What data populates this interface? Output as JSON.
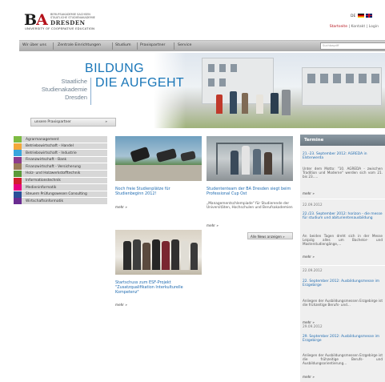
{
  "header": {
    "logo_mark": "BA",
    "logo_subtitle": "BERUFSAKADEMIE SACHSEN STAATLICHE STUDIENAKADEMIE",
    "logo_city": "DRESDEN",
    "logo_university": "UNIVERSITY OF COOPERATIVE EDUCATION",
    "lang_label": "DE",
    "toplinks": {
      "startseite": "Startseite",
      "sep": " | ",
      "kontakt": "Kontakt",
      "login": "Login"
    }
  },
  "nav": {
    "items": [
      "Wir über uns",
      "Zentrale Einrichtungen",
      "Studium",
      "Praxispartner",
      "Service"
    ],
    "search_placeholder": "Suchbegriff"
  },
  "hero": {
    "line1": "BILDUNG",
    "line2": "DIE AUFGEHT",
    "institution": [
      "Staatliche",
      "Studienakademie",
      "Dresden"
    ],
    "partner_button": "unsere Praxispartner",
    "partner_arrow": "»"
  },
  "sidebar": {
    "items": [
      {
        "label": "Agrarmanagement",
        "color": "#7dbb42"
      },
      {
        "label": "Betriebswirtschaft - Handel",
        "color": "#f2a73b"
      },
      {
        "label": "Betriebswirtschaft - Industrie",
        "color": "#3aa6dd"
      },
      {
        "label": "Finanzwirtschaft - Bank",
        "color": "#8e3c8c"
      },
      {
        "label": "Finanzwirtschaft - Versicherung",
        "color": "#9b7b57"
      },
      {
        "label": "Holz- und Holzwerkstofftechnik",
        "color": "#5c9a3a"
      },
      {
        "label": "Informationstechnik",
        "color": "#d21f2e"
      },
      {
        "label": "Medieninformatik",
        "color": "#e6007e"
      },
      {
        "label": "Steuern Prüfungswesen Consulting",
        "color": "#2a4f9a"
      },
      {
        "label": "Wirtschaftsinformatik",
        "color": "#6a2c91"
      }
    ]
  },
  "news": [
    {
      "title": "Noch freie Studienplätze für Studienbeginn 2012!",
      "text": "",
      "more": "mehr »"
    },
    {
      "title": "Studententeam der BA Dresden siegt beim Professional Cup Ost",
      "text": "„Managementschlempiade\" für Studierende der Universitäten, Hochschulen und Berufsakademien",
      "more": "mehr »"
    },
    {
      "title": "Startschuss zum ESF-Projekt \"Zusatzqualifikation Interkulturelle Kompetenz\"",
      "text": "",
      "more": "mehr »"
    }
  ],
  "all_news": "Alle News anzeigen  »",
  "termine": {
    "heading": "Termine",
    "entries": [
      {
        "date": "",
        "title": "21.-23. September 2012: AGREDA in Elsterwerda",
        "body": "Unter dem Motto: \"10. AGREDA - zwischen Tradition und Moderne\" werden sich vom 21. bis 23.....",
        "more": "mehr »"
      },
      {
        "date": "22.09.2012",
        "title": "22./23. September 2012: horizon - die messe für studium und abiturientenausbildung",
        "body": "An beiden Tagen dreht sich in der Messe Leipzig alles um Bachelor- und Masterstudiengänge,...",
        "more": "mehr »"
      },
      {
        "date": "22.09.2012",
        "title": "22. September 2012: Ausbildungsmesse im Erzgebirge",
        "body": "Anliegen der Ausbildungsmessen Erzgebirge ist die frühzeitige Berufs- und...",
        "more": "mehr »"
      },
      {
        "date": "29.09.2012",
        "title": "29. September 2012: Ausbildungsmesse im Erzgebirge",
        "body": "Anliegen der Ausbildungsmessen Erzgebirge ist die frühzeitige Berufs- und Ausbildungsorientierung...",
        "more": "mehr »"
      }
    ]
  }
}
